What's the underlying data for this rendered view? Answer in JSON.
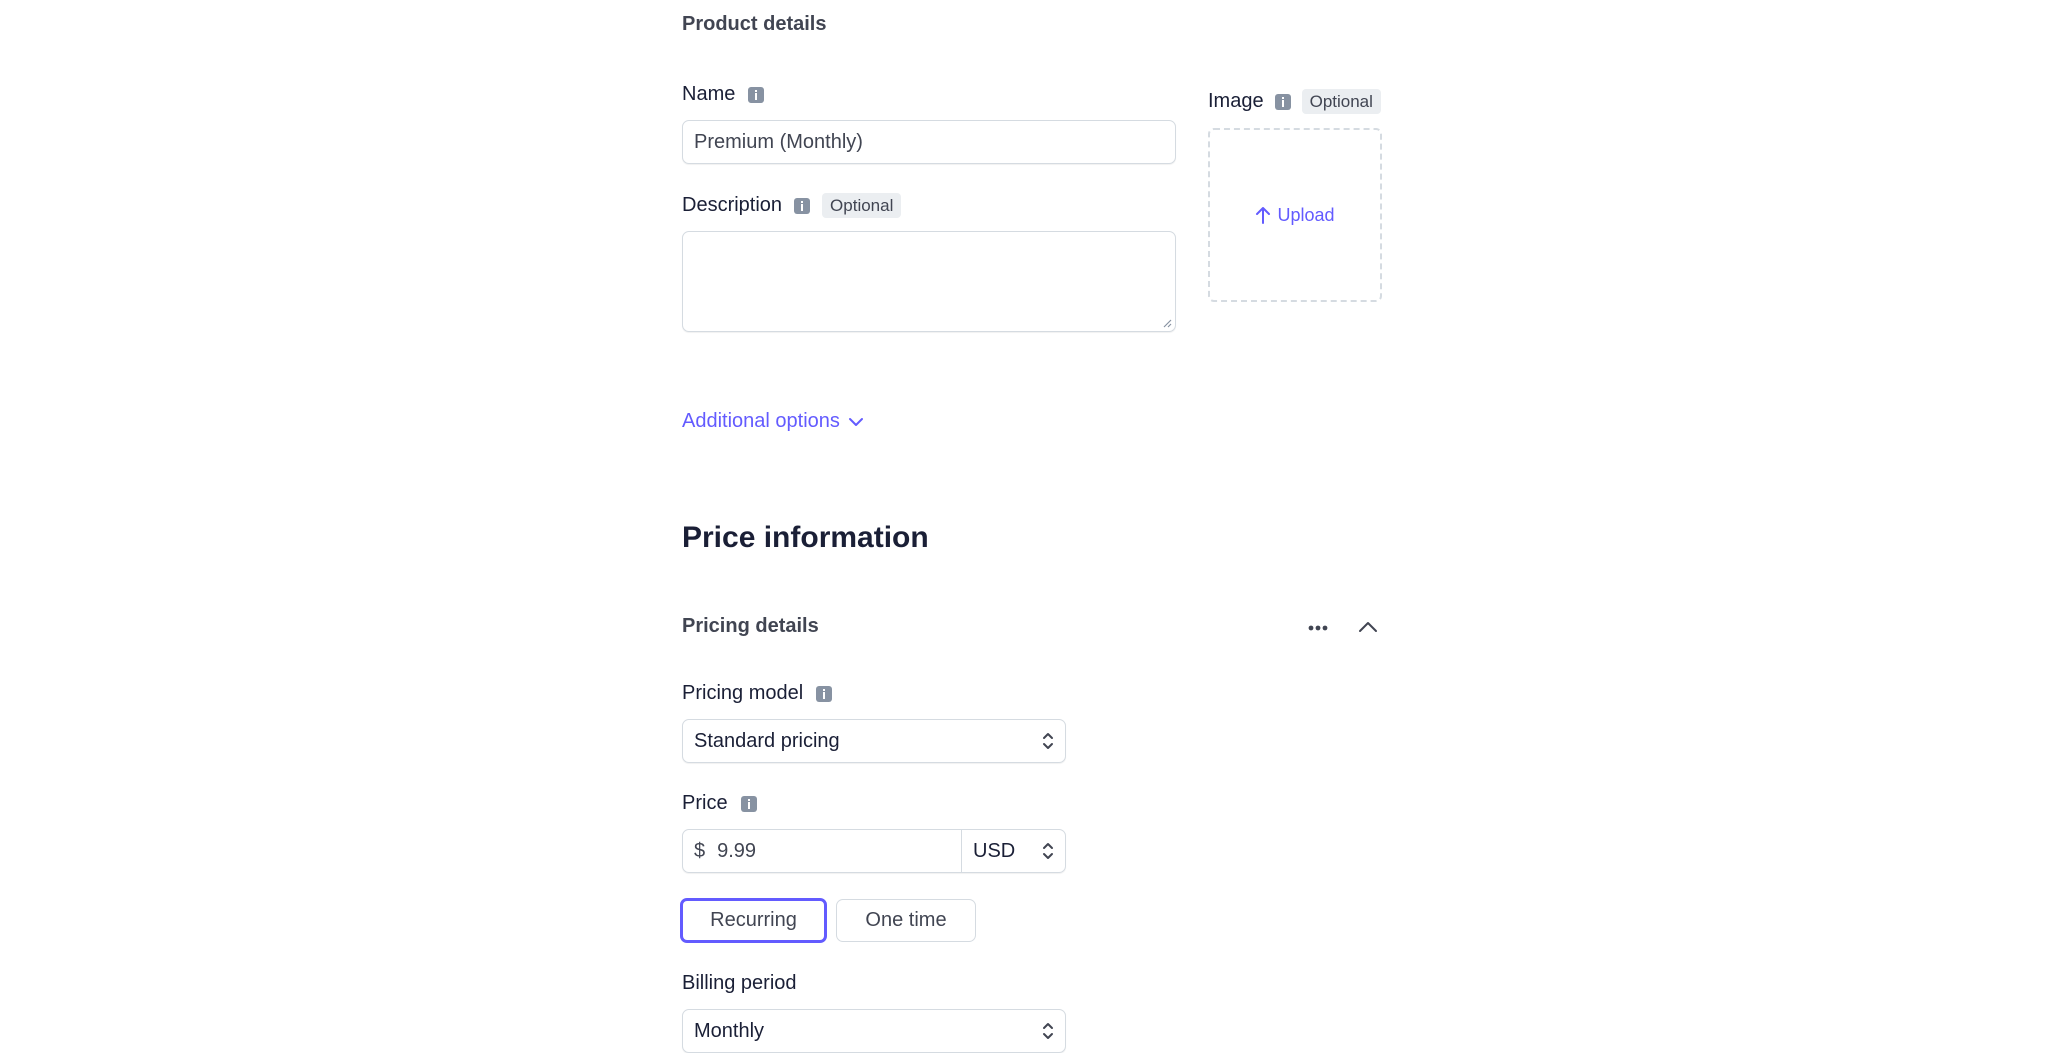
{
  "product_details": {
    "heading": "Product details",
    "name": {
      "label": "Name",
      "value": "Premium (Monthly)"
    },
    "description": {
      "label": "Description",
      "optional": "Optional",
      "value": ""
    },
    "image": {
      "label": "Image",
      "optional": "Optional",
      "upload_label": "Upload"
    },
    "additional_options": "Additional options"
  },
  "price_information": {
    "heading": "Price information",
    "pricing_details": {
      "heading": "Pricing details",
      "pricing_model": {
        "label": "Pricing model",
        "value": "Standard pricing"
      },
      "price": {
        "label": "Price",
        "currency_symbol": "$",
        "value": "9.99",
        "currency": "USD"
      },
      "type_options": [
        {
          "label": "Recurring",
          "selected": true
        },
        {
          "label": "One time",
          "selected": false
        }
      ],
      "billing_period": {
        "label": "Billing period",
        "value": "Monthly"
      }
    }
  },
  "colors": {
    "accent": "#635bff",
    "border": "#d5dbe1",
    "text": "#1a1f36",
    "muted": "#8792a2"
  },
  "icons": [
    "info-icon",
    "upload-arrow-icon",
    "chevron-down-icon",
    "more-icon",
    "chevron-up-icon",
    "select-arrows-icon"
  ]
}
